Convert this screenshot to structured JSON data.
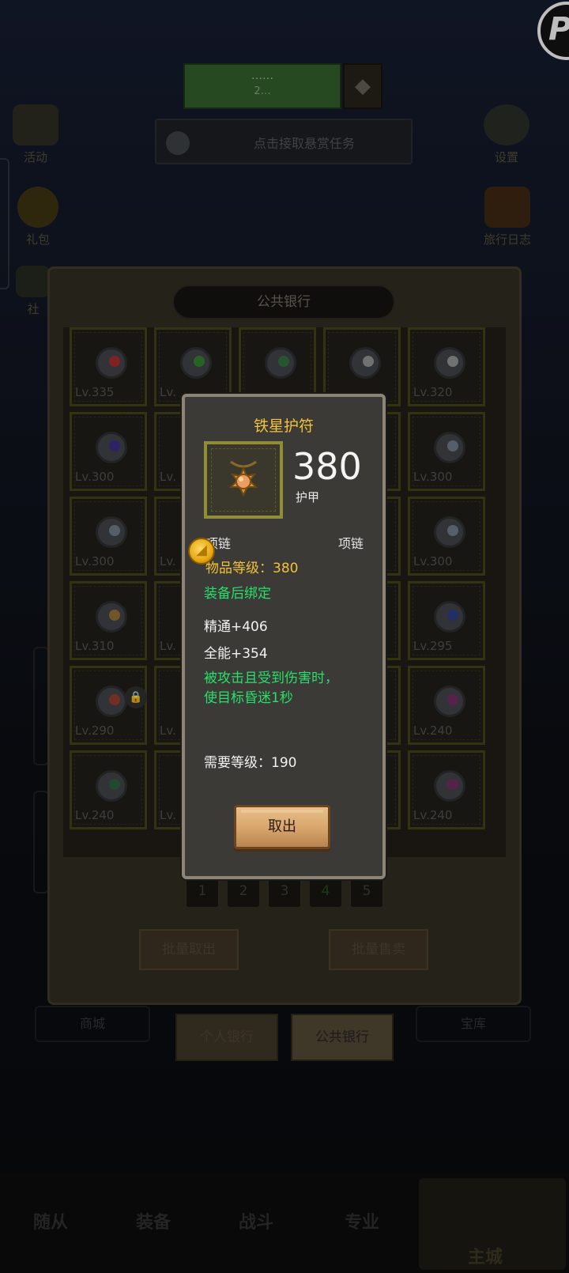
{
  "background": {
    "quest_bar": {
      "line1": "……",
      "line2": "2…"
    },
    "bounty_task": "点击接取悬赏任务",
    "left_icons": [
      {
        "label": "活动"
      },
      {
        "label": "礼包"
      },
      {
        "label": "社"
      }
    ],
    "right_icons": [
      {
        "label": "设置"
      },
      {
        "label": "旅行日志"
      }
    ]
  },
  "bank": {
    "title": "公共银行",
    "slots": [
      {
        "level": "Lv.335",
        "gem": "#9b2a2a"
      },
      {
        "level": "Lv.",
        "gem": "#2e7a2e"
      },
      {
        "level": "",
        "gem": "#2e6a3a"
      },
      {
        "level": "",
        "gem": "#8a8a8a"
      },
      {
        "level": "Lv.320",
        "gem": "#8a8a8a"
      },
      {
        "level": "Lv.300",
        "gem": "#3a2a7a"
      },
      {
        "level": "Lv.",
        "gem": ""
      },
      {
        "level": "",
        "gem": ""
      },
      {
        "level": "",
        "gem": ""
      },
      {
        "level": "Lv.300",
        "gem": "#6a7480"
      },
      {
        "level": "Lv.300",
        "gem": "#6a7480"
      },
      {
        "level": "Lv.",
        "gem": ""
      },
      {
        "level": "",
        "gem": ""
      },
      {
        "level": "",
        "gem": ""
      },
      {
        "level": "Lv.300",
        "gem": "#6a7480"
      },
      {
        "level": "Lv.310",
        "gem": "#8a6a30"
      },
      {
        "level": "Lv.",
        "gem": ""
      },
      {
        "level": "",
        "gem": ""
      },
      {
        "level": "",
        "gem": ""
      },
      {
        "level": "Lv.295",
        "gem": "#2a3a7a"
      },
      {
        "level": "Lv.290",
        "gem": "#8a3a2a"
      },
      {
        "level": "Lv.",
        "gem": ""
      },
      {
        "level": "",
        "gem": ""
      },
      {
        "level": "",
        "gem": ""
      },
      {
        "level": "Lv.240",
        "gem": "#6a2a5a"
      },
      {
        "level": "Lv.240",
        "gem": "#2a5a3a"
      },
      {
        "level": "Lv.",
        "gem": ""
      },
      {
        "level": "",
        "gem": ""
      },
      {
        "level": "",
        "gem": ""
      },
      {
        "level": "Lv.240",
        "gem": "#6a2a5a"
      }
    ],
    "pages": [
      "1",
      "2",
      "3",
      "4",
      "5"
    ],
    "current_page": "4",
    "bulk_take": "批量取出",
    "bulk_sell": "批量售卖",
    "tab_personal": "个人银行",
    "tab_public": "公共银行",
    "ghost_left": "商城",
    "ghost_right": "宝库"
  },
  "tooltip": {
    "item_name": "铁星护符",
    "stat_value": "380",
    "stat_label": "护甲",
    "slot": "项链",
    "type": "项链",
    "item_level": "物品等级：380",
    "bind": "装备后绑定",
    "attr1": "精通+406",
    "attr2": "全能+354",
    "effect": "被攻击且受到伤害时，使目标昏迷1秒",
    "required_level": "需要等级：190",
    "take_out_button": "取出"
  },
  "nav": {
    "items": [
      "随从",
      "装备",
      "战斗",
      "专业"
    ],
    "main_city": "主城"
  },
  "colors": {
    "item_name": "#f2c23a",
    "green_text": "#27e06a",
    "panel": "#3b3a36",
    "border": "#8c8577"
  }
}
